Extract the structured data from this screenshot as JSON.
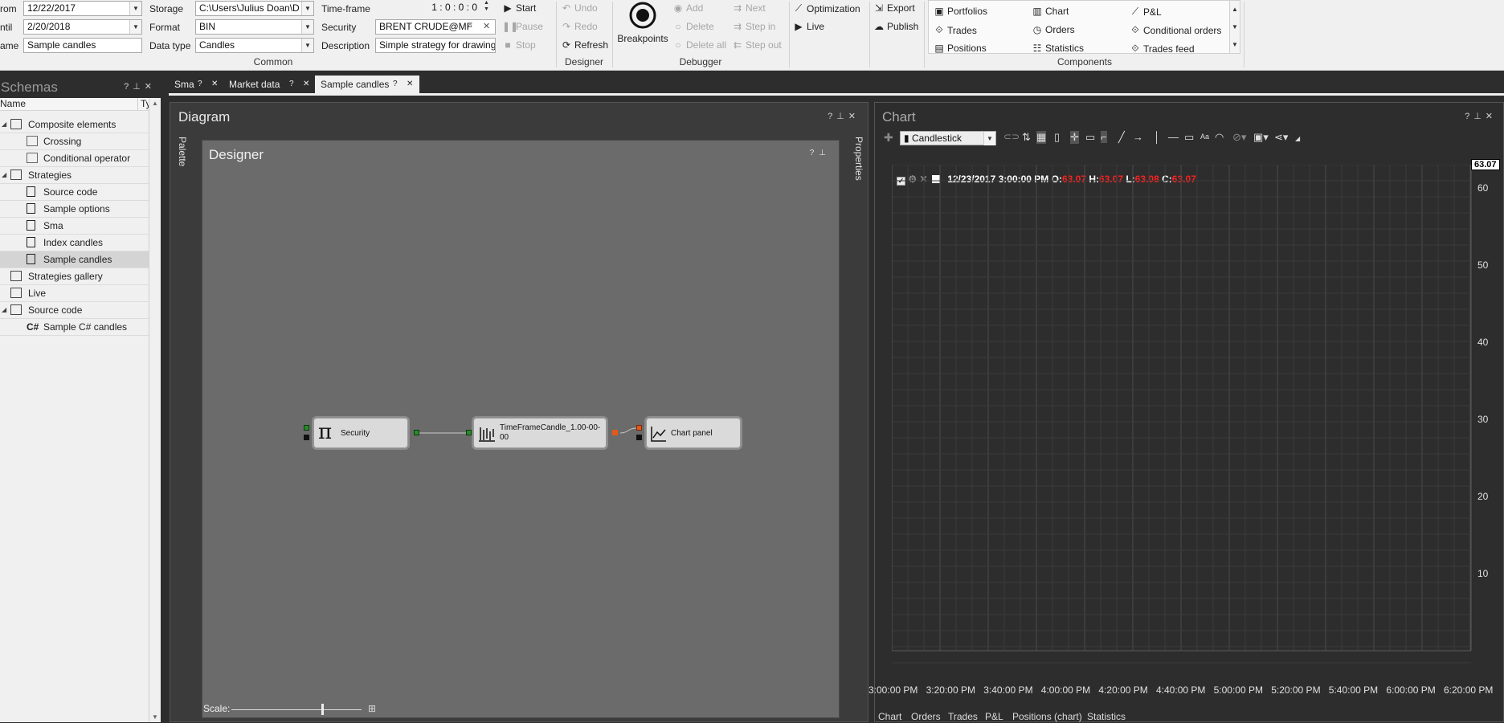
{
  "ribbon": {
    "from_label": "rom",
    "from_value": "12/22/2017",
    "until_label": "ntil",
    "until_value": "2/20/2018",
    "name_label": "ame",
    "name_value": "Sample candles",
    "storage_label": "Storage",
    "storage_value": "C:\\Users\\Julius Doan\\D",
    "format_label": "Format",
    "format_value": "BIN",
    "datatype_label": "Data type",
    "datatype_value": "Candles",
    "timeframe_label": "Time-frame",
    "timeframe_value": "1 : 0 : 0 : 0",
    "security_label": "Security",
    "security_value": "BRENT CRUDE@MF",
    "description_label": "Description",
    "description_value": "Simple strategy for drawing",
    "common_group": "Common",
    "start": "Start",
    "pause": "Pause",
    "stop": "Stop",
    "undo": "Undo",
    "redo": "Redo",
    "refresh": "Refresh",
    "designer_group": "Designer",
    "breakpoints": "Breakpoints",
    "add": "Add",
    "delete": "Delete",
    "delete_all": "Delete all",
    "next": "Next",
    "step_in": "Step in",
    "step_out": "Step out",
    "debugger_group": "Debugger",
    "optimization": "Optimization",
    "live": "Live",
    "export": "Export",
    "publish": "Publish",
    "components": {
      "col1": [
        "Portfolios",
        "Trades",
        "Positions"
      ],
      "col2": [
        "Chart",
        "Orders",
        "Statistics"
      ],
      "col3": [
        "P&L",
        "Conditional orders",
        "Trades feed"
      ]
    },
    "components_group": "Components"
  },
  "schemas": {
    "title": "Schemas",
    "col_name": "Name",
    "col_type": "Ty",
    "items": [
      {
        "label": "Composite elements"
      },
      {
        "label": "Crossing"
      },
      {
        "label": "Conditional operator"
      },
      {
        "label": "Strategies"
      },
      {
        "label": "Source code"
      },
      {
        "label": "Sample options"
      },
      {
        "label": "Sma"
      },
      {
        "label": "Index candles"
      },
      {
        "label": "Sample candles"
      },
      {
        "label": "Strategies gallery"
      },
      {
        "label": "Live"
      },
      {
        "label": "Source code"
      },
      {
        "label": "Sample C# candles"
      }
    ]
  },
  "tabs": [
    {
      "label": "Sma"
    },
    {
      "label": "Market data"
    },
    {
      "label": "Sample candles"
    }
  ],
  "diagram": {
    "title": "Diagram",
    "palette": "Palette",
    "properties": "Properties",
    "designer_title": "Designer",
    "scale_label": "Scale:",
    "scale_level": 0.7,
    "nodes": {
      "security": "Security",
      "timeframe": "TimeFrameCandle_1.00-00-00",
      "chart_panel": "Chart panel"
    }
  },
  "chart": {
    "title": "Chart",
    "chart_type": "Candlestick",
    "legend_date": "12/23/2017 3:00:00 PM",
    "legend_o_label": "O:",
    "legend_o": "63.07",
    "legend_h_label": "H:",
    "legend_h": "63.07",
    "legend_l_label": "L:",
    "legend_l": "63.08",
    "legend_c_label": "C:",
    "legend_c": "63.07",
    "current_price": "63.07",
    "y_ticks": [
      "60",
      "50",
      "40",
      "30",
      "20",
      "10"
    ],
    "x_ticks": [
      "3:00:00 PM",
      "3:20:00 PM",
      "3:40:00 PM",
      "4:00:00 PM",
      "4:20:00 PM",
      "4:40:00 PM",
      "5:00:00 PM",
      "5:20:00 PM",
      "5:40:00 PM",
      "6:00:00 PM",
      "6:20:00 PM"
    ],
    "bottom_tabs": [
      "Chart",
      "Orders",
      "Trades",
      "P&L",
      "Positions (chart)",
      "Statistics"
    ]
  },
  "colors": {
    "price_red": "#ff2020",
    "accent_green": "#2a8a2a",
    "port_orange": "#e05a1a"
  }
}
